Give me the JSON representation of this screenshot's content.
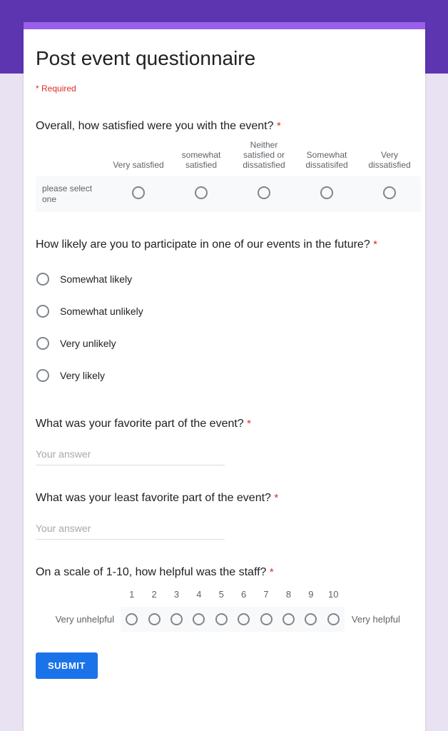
{
  "theme": {
    "banner_color": "#5e35b1",
    "accent_bar_color": "#9860ea",
    "page_background": "#e9e2f2",
    "required_color": "#d93025",
    "submit_color": "#1a73e8",
    "row_stripe_color": "#f8f9fa"
  },
  "header": {
    "title": "Post event questionnaire",
    "required_note": "* Required"
  },
  "questions": [
    {
      "id": "satisfaction-grid",
      "type": "multiple-choice-grid",
      "title": "Overall, how satisfied were you with the event?",
      "required_marker": "*",
      "columns": [
        "Very satisfied",
        "somewhat satisfied",
        "Neither satisfied or dissatisfied",
        "Somewhat dissatisifed",
        "Very dissatisfied"
      ],
      "rows": [
        {
          "label": "please select one",
          "selected": null
        }
      ]
    },
    {
      "id": "future-participation",
      "type": "multiple-choice",
      "title": "How likely are you to participate in one of our events in the future?",
      "required_marker": "*",
      "options": [
        "Somewhat likely",
        "Somewhat unlikely",
        "Very unlikely",
        "Very likely"
      ],
      "selected": null
    },
    {
      "id": "favorite-part",
      "type": "short-answer",
      "title": "What was your favorite part of the event?",
      "required_marker": "*",
      "value": "",
      "placeholder": "Your answer"
    },
    {
      "id": "least-favorite-part",
      "type": "short-answer",
      "title": "What was your least favorite part of the event?",
      "required_marker": "*",
      "value": "",
      "placeholder": "Your answer"
    },
    {
      "id": "staff-helpfulness",
      "type": "linear-scale",
      "title": "On a scale of 1-10, how helpful was the staff?",
      "required_marker": "*",
      "ticks": [
        "1",
        "2",
        "3",
        "4",
        "5",
        "6",
        "7",
        "8",
        "9",
        "10"
      ],
      "low_label": "Very unhelpful",
      "high_label": "Very helpful",
      "selected": null
    }
  ],
  "footer": {
    "submit_label": "SUBMIT"
  }
}
